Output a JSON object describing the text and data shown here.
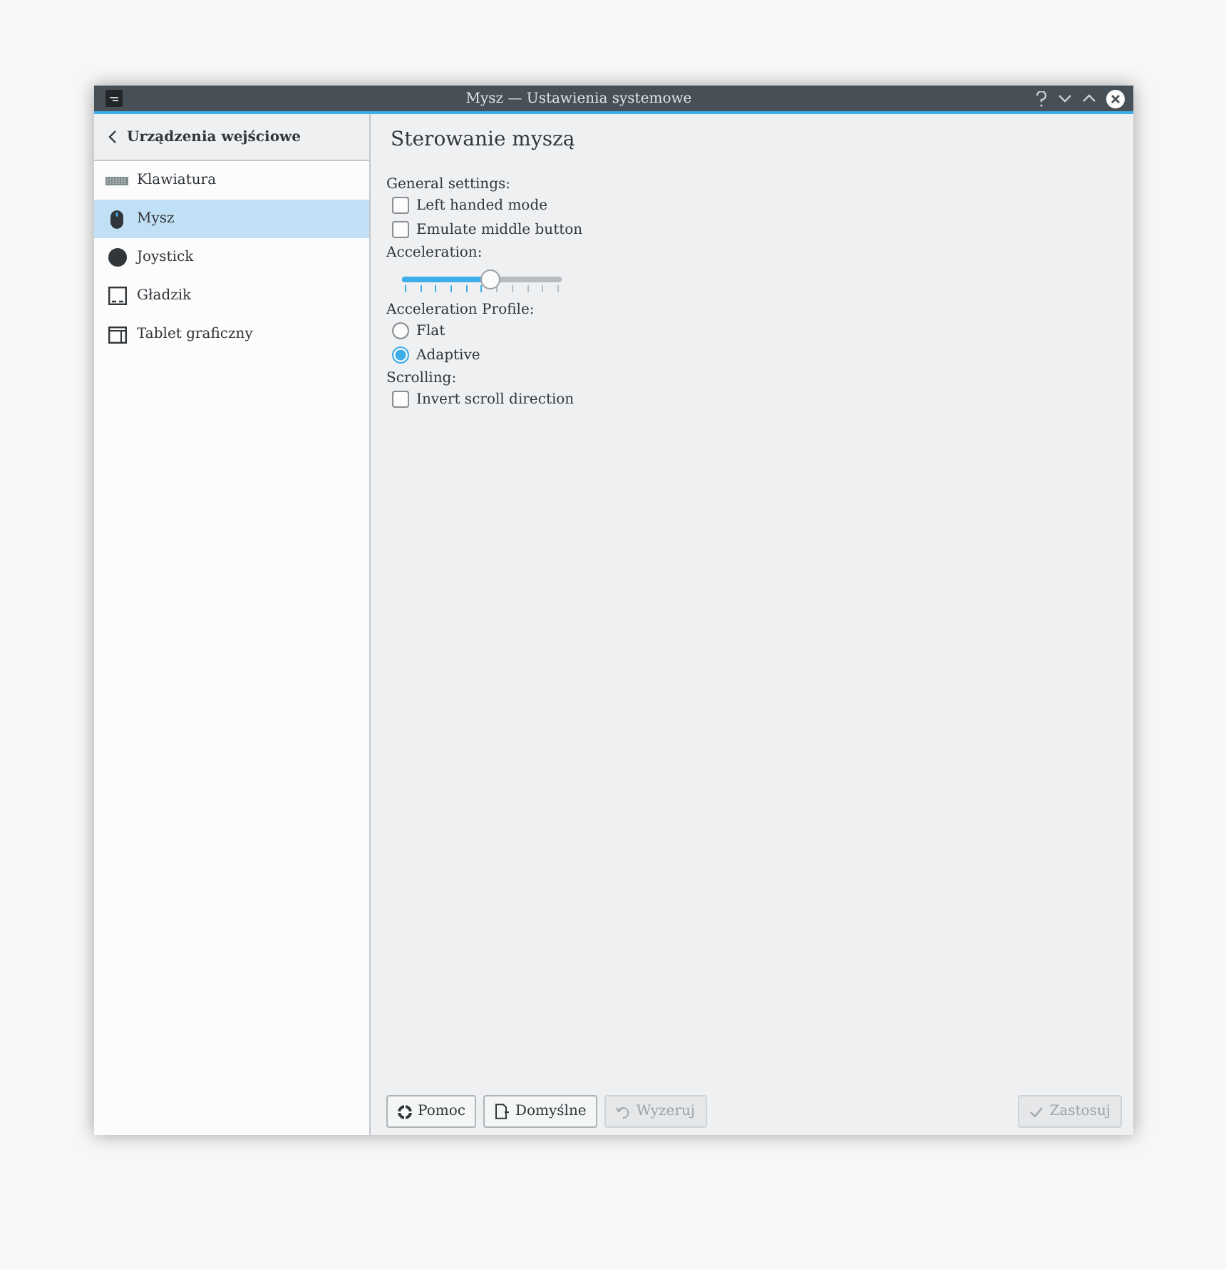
{
  "window": {
    "title": "Mysz — Ustawienia systemowe"
  },
  "sidebar": {
    "header": "Urządzenia wejściowe",
    "items": [
      {
        "label": "Klawiatura",
        "selected": false
      },
      {
        "label": "Mysz",
        "selected": true
      },
      {
        "label": "Joystick",
        "selected": false
      },
      {
        "label": "Gładzik",
        "selected": false
      },
      {
        "label": "Tablet graficzny",
        "selected": false
      }
    ]
  },
  "content": {
    "title": "Sterowanie myszą",
    "sections": [
      {
        "label": "General settings:",
        "controls": [
          {
            "kind": "checkbox",
            "label": "Left handed mode",
            "checked": false
          },
          {
            "kind": "checkbox",
            "label": "Emulate middle button",
            "checked": false
          }
        ]
      },
      {
        "label": "Acceleration:",
        "controls": [
          {
            "kind": "slider",
            "level": 0.55
          }
        ]
      },
      {
        "label": "Acceleration Profile:",
        "controls": [
          {
            "kind": "radio",
            "label": "Flat",
            "selected": false
          },
          {
            "kind": "radio",
            "label": "Adaptive",
            "selected": true
          }
        ]
      },
      {
        "label": "Scrolling:",
        "controls": [
          {
            "kind": "checkbox",
            "label": "Invert scroll direction",
            "checked": false
          }
        ]
      }
    ]
  },
  "buttons_left": [
    {
      "label": "Pomoc",
      "disabled": false
    },
    {
      "label": "Domyślne",
      "disabled": false
    },
    {
      "label": "Wyzeruj",
      "disabled": true
    }
  ],
  "buttons_right": [
    {
      "label": "Zastosuj",
      "disabled": true
    }
  ]
}
